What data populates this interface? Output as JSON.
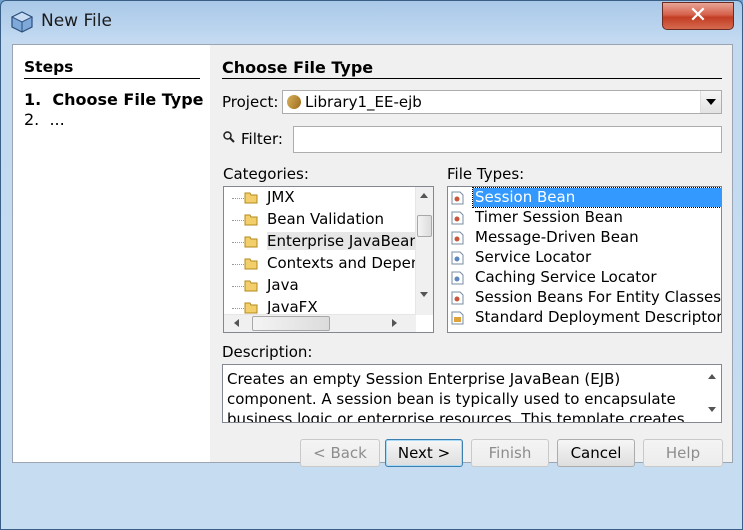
{
  "window": {
    "title": "New File",
    "close_glyph": "✕"
  },
  "steps": {
    "title": "Steps",
    "items": [
      {
        "num": "1.",
        "label": "Choose File Type"
      },
      {
        "num": "2.",
        "label": "..."
      }
    ]
  },
  "main": {
    "title": "Choose File Type",
    "project_label": "Project:",
    "project_value": "Library1_EE-ejb",
    "filter_label": "Filter:",
    "filter_value": "",
    "categories_label": "Categories:",
    "categories": [
      "JMX",
      "Bean Validation",
      "Enterprise JavaBeans",
      "Contexts and Dependency Injection",
      "Java",
      "JavaFX"
    ],
    "file_types_label": "File Types:",
    "file_types": [
      "Session Bean",
      "Timer Session Bean",
      "Message-Driven Bean",
      "Service Locator",
      "Caching Service Locator",
      "Session Beans For Entity Classes",
      "Standard Deployment Descriptor"
    ],
    "selected_file_type": "Session Bean",
    "description_label": "Description:",
    "description": "Creates an empty Session Enterprise JavaBean (EJB) component. A session bean is typically used to encapsulate business logic or enterprise resources. This template creates the Java classes for a"
  },
  "buttons": {
    "back": "< Back",
    "next": "Next >",
    "finish": "Finish",
    "cancel": "Cancel",
    "help": "Help"
  },
  "colors": {
    "selection": "#3399ff",
    "close_button": "#c23d23"
  }
}
